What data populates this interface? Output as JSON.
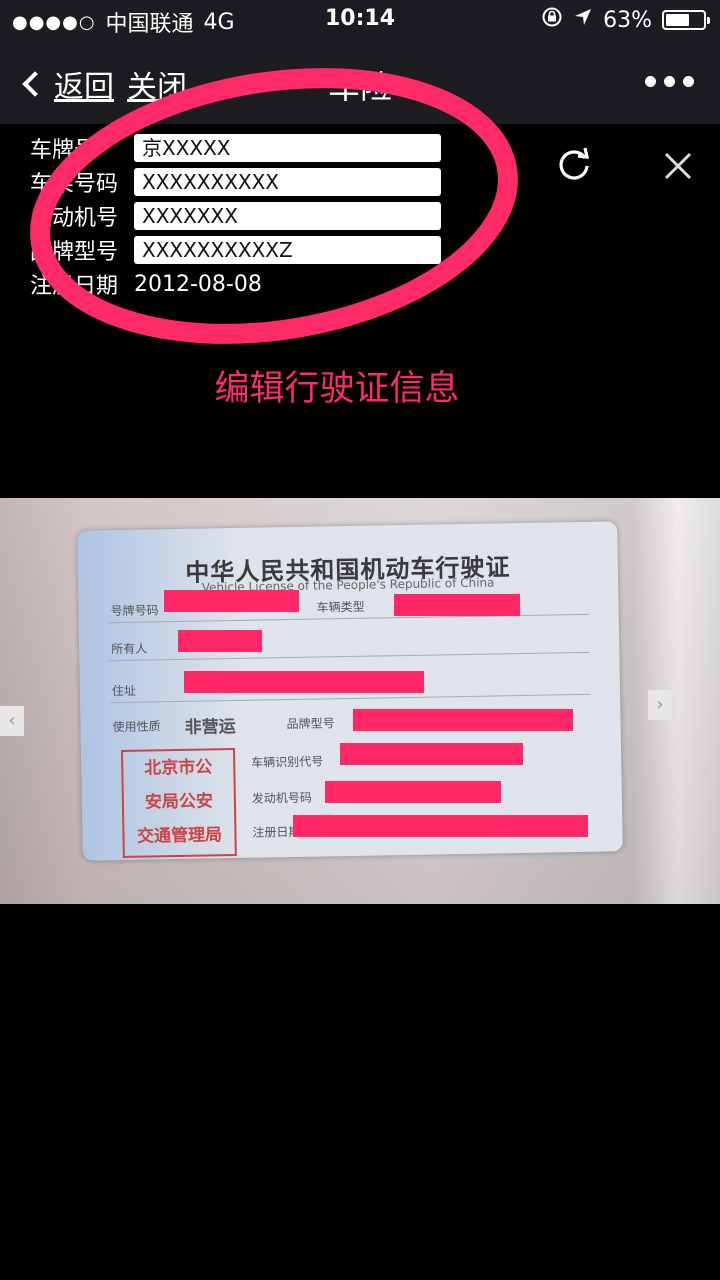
{
  "status": {
    "signal": "●●●●○",
    "carrier": "中国联通",
    "network": "4G",
    "time": "10:14",
    "battery": "63%",
    "battery_level": 0.63
  },
  "nav": {
    "back_label": "返回",
    "close_label": "关闭",
    "title": "车险"
  },
  "form": {
    "rows": [
      {
        "label": "车牌号",
        "value": "京XXXXX"
      },
      {
        "label": "车架号码",
        "value": "XXXXXXXXXX"
      },
      {
        "label": "发动机号",
        "value": "XXXXXXX"
      },
      {
        "label": "品牌型号",
        "value": "XXXXXXXXXXZ"
      },
      {
        "label": "注册日期",
        "value": "2012-08-08"
      }
    ]
  },
  "edit_link": "编辑行驶证信息",
  "license": {
    "title_cn": "中华人民共和国机动车行驶证",
    "title_en": "Vehicle License of the People's Republic of China",
    "labels": {
      "plate": "号牌号码",
      "type": "车辆类型",
      "owner": "所有人",
      "address": "住址",
      "use": "使用性质",
      "model": "品牌型号",
      "vin": "车辆识别代号",
      "engine": "发动机号码",
      "register": "注册日期"
    },
    "use_value": "非营运",
    "stamp_lines": [
      "北京市公",
      "安局公安",
      "交通管理局"
    ]
  },
  "colors": {
    "accent": "#ff2a68",
    "bar": "#1d1d21",
    "redaction": "#ff2968"
  }
}
